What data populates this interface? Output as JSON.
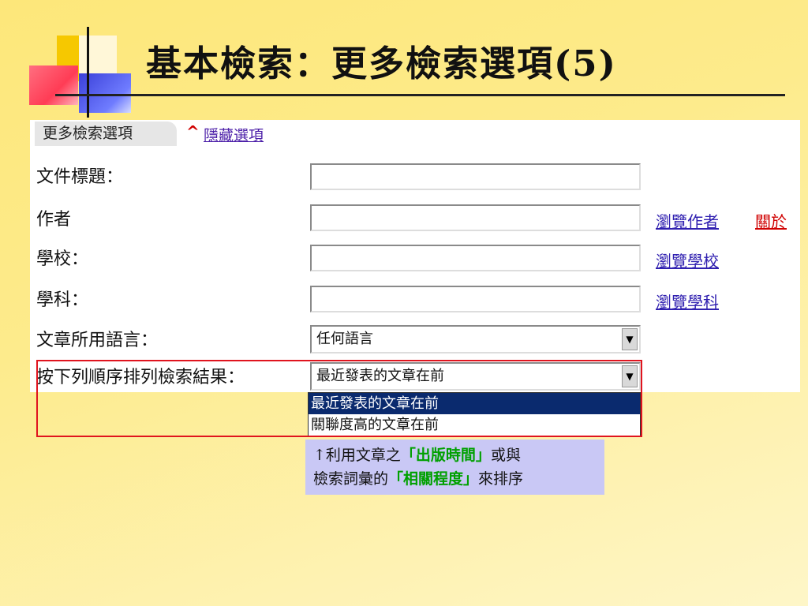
{
  "title": "基本檢索：更多檢索選項(5)",
  "panel": {
    "tab_label": "更多檢索選項",
    "caret": "^",
    "hide_link": "隱藏選項"
  },
  "fields": {
    "doc_title_label": "文件標題：",
    "author_label": "作者",
    "school_label": "學校：",
    "subject_label": "學科：",
    "language_label": "文章所用語言：",
    "language_value": "任何語言",
    "sort_label": "按下列順序排列檢索結果：",
    "sort_value": "最近發表的文章在前"
  },
  "links": {
    "browse_author": "瀏覽作者",
    "about": "關於",
    "browse_school": "瀏覽學校",
    "browse_subject": "瀏覽學科"
  },
  "dropdown": {
    "options": [
      "最近發表的文章在前",
      "關聯度高的文章在前"
    ],
    "selected_index": 0
  },
  "callout": {
    "line1_prefix": "↑利用文章之",
    "line1_highlight": "「出版時間」",
    "line1_suffix": "或與",
    "line2_prefix": "檢索詞彙的",
    "line2_highlight": "「相關程度」",
    "line2_suffix": "來排序"
  },
  "icons": {
    "dropdown_arrow": "chevron-down-icon",
    "logo": "slide-logo-icon"
  },
  "colors": {
    "link": "#3020b0",
    "about_link": "#d00000",
    "highlight": "#00a000",
    "selected_option_bg": "#0a2a6e",
    "callout_bg": "#c9c8f5"
  }
}
